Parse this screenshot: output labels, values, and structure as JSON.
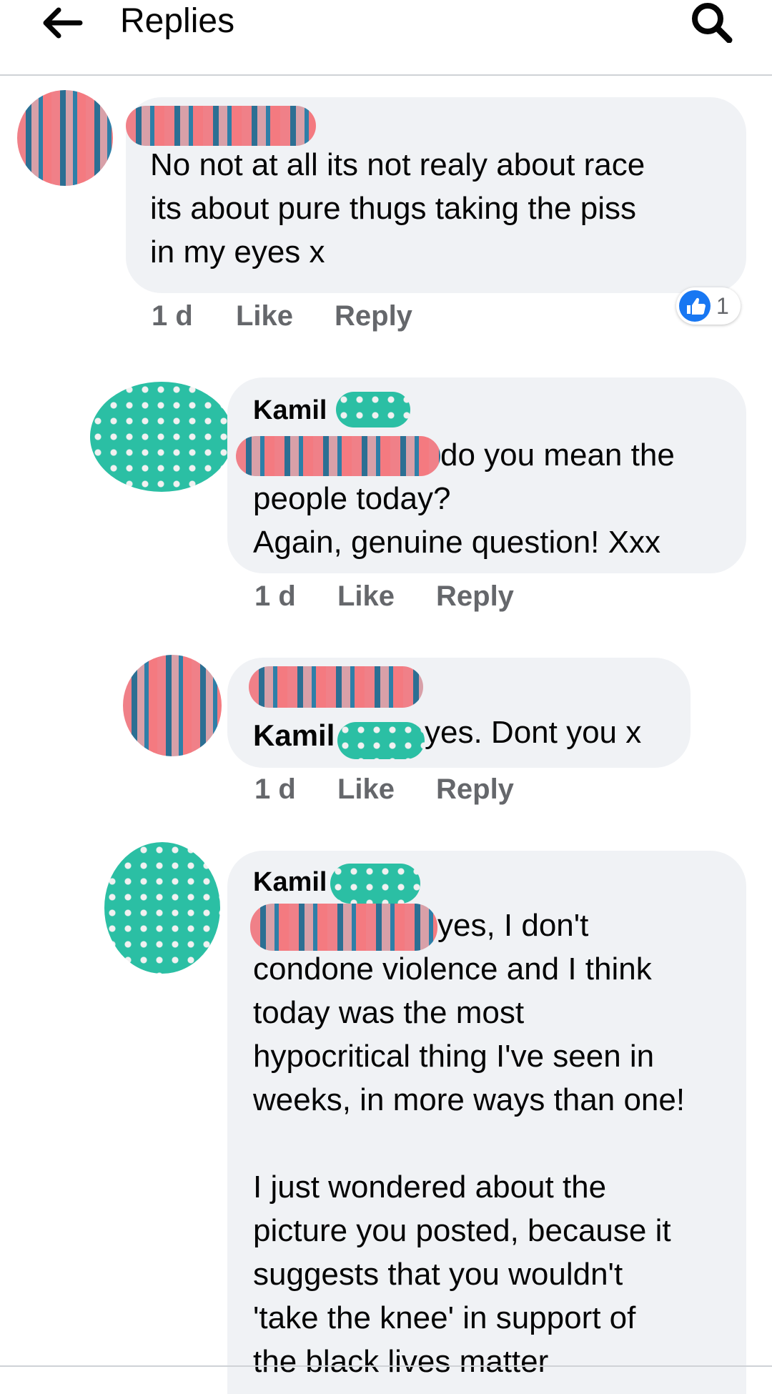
{
  "header": {
    "title": "Replies"
  },
  "comments": [
    {
      "name": "",
      "text": "No not at all its not realy about race\nits about pure thugs taking the piss\nin my eyes x",
      "time": "1 d",
      "like": "Like",
      "reply": "Reply",
      "reaction_count": "1"
    },
    {
      "name": "Kamil",
      "mention_suffix": "do you mean the",
      "text": "people today?\nAgain, genuine question! Xxx",
      "time": "1 d",
      "like": "Like",
      "reply": "Reply"
    },
    {
      "name": "",
      "mention": "Kamil",
      "mention_suffix": "yes. Dont you x",
      "time": "1 d",
      "like": "Like",
      "reply": "Reply"
    },
    {
      "name": "Kamil",
      "mention_suffix": "yes, I don't",
      "text": "condone violence and I think\ntoday was the most\nhypocritical thing I've seen in\nweeks, in more ways than one!\n\nI just wondered about the\npicture you posted, because it\nsuggests that you wouldn't\n'take the knee' in support of\nthe black lives matter"
    }
  ],
  "colors": {
    "bubble": "#f0f2f5",
    "meta": "#65676b",
    "accent": "#1877f2"
  },
  "icons": {
    "back": "arrow-left-icon",
    "search": "search-icon",
    "reaction": "like-icon"
  }
}
